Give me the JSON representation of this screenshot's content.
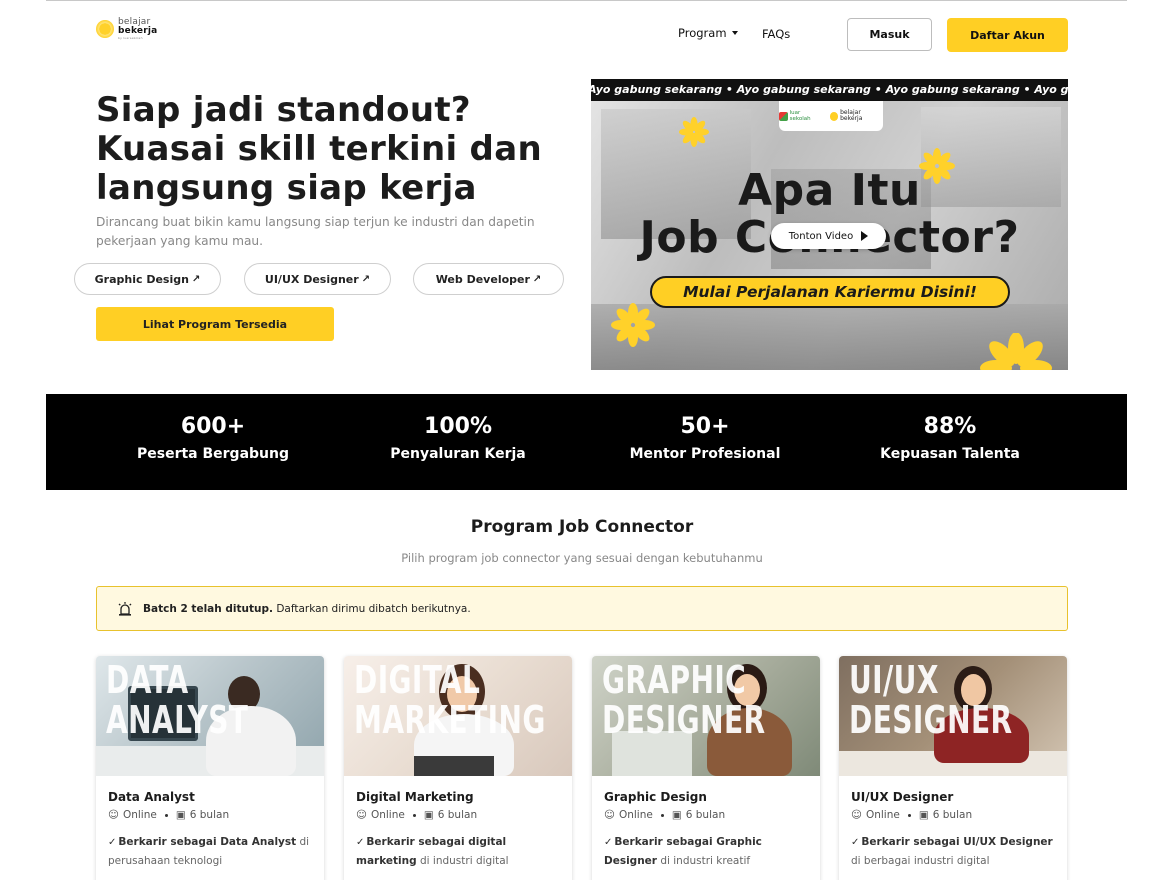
{
  "brand": {
    "line1": "belajar",
    "line2": "bekerja",
    "line3": "by luarsekolah"
  },
  "nav": {
    "program": "Program",
    "faq": "FAQs",
    "login": "Masuk",
    "register": "Daftar Akun"
  },
  "hero": {
    "title_lines": [
      "Siap jadi standout?",
      "Kuasai skill terkini dan",
      "langsung siap kerja"
    ],
    "description": "Dirancang buat bikin kamu langsung siap terjun ke industri dan dapetin pekerjaan yang kamu mau.",
    "chips": [
      "Graphic Design",
      "UI/UX Designer",
      "Web Developer"
    ],
    "cta": "Lihat Program Tersedia"
  },
  "video": {
    "marquee": "Ayo gabung sekarang • Ayo gabung sekarang • Ayo gabung sekarang • Ayo gabung sekarang",
    "logo_left": "luar sekolah",
    "logo_right": "belajar bekerja",
    "title_line1": "Apa Itu",
    "title_line2": "Job Connector?",
    "subtitle": "Mulai Perjalanan Kariermu Disini!",
    "play_label": "Tonton Video"
  },
  "stats": [
    {
      "value": "600+",
      "label": "Peserta Bergabung"
    },
    {
      "value": "100%",
      "label": "Penyaluran Kerja"
    },
    {
      "value": "50+",
      "label": "Mentor Profesional"
    },
    {
      "value": "88%",
      "label": "Kepuasan Talenta"
    }
  ],
  "section": {
    "title": "Program Job Connector",
    "subtitle": "Pilih program job connector yang sesuai dengan kebutuhanmu",
    "alert_bold": "Batch 2 telah ditutup.",
    "alert_text": " Daftarkan dirimu dibatch berikutnya."
  },
  "cards": [
    {
      "image_text": [
        "DATA",
        "ANALYST"
      ],
      "title": "Data Analyst",
      "mode": "Online",
      "duration": "6 bulan",
      "feature_bold": "Berkarir sebagai Data Analyst",
      "feature_rest": " di perusahaan teknologi"
    },
    {
      "image_text": [
        "DIGITAL",
        "MARKETING"
      ],
      "title": "Digital Marketing",
      "mode": "Online",
      "duration": "6 bulan",
      "feature_bold": "Berkarir sebagai digital marketing",
      "feature_rest": " di industri digital"
    },
    {
      "image_text": [
        "GRAPHIC",
        "DESIGNER"
      ],
      "title": "Graphic Design",
      "mode": "Online",
      "duration": "6 bulan",
      "feature_bold": "Berkarir sebagai Graphic Designer",
      "feature_rest": " di industri kreatif"
    },
    {
      "image_text": [
        "UI/UX",
        "DESIGNER"
      ],
      "title": "UI/UX Designer",
      "mode": "Online",
      "duration": "6 bulan",
      "feature_bold": "Berkarir sebagai UI/UX Designer",
      "feature_rest": " di berbagai industri digital"
    }
  ],
  "colors": {
    "accent": "#ffcf24",
    "dark": "#000000",
    "alert_bg": "#fff9e0",
    "alert_border": "#e8c22d"
  }
}
